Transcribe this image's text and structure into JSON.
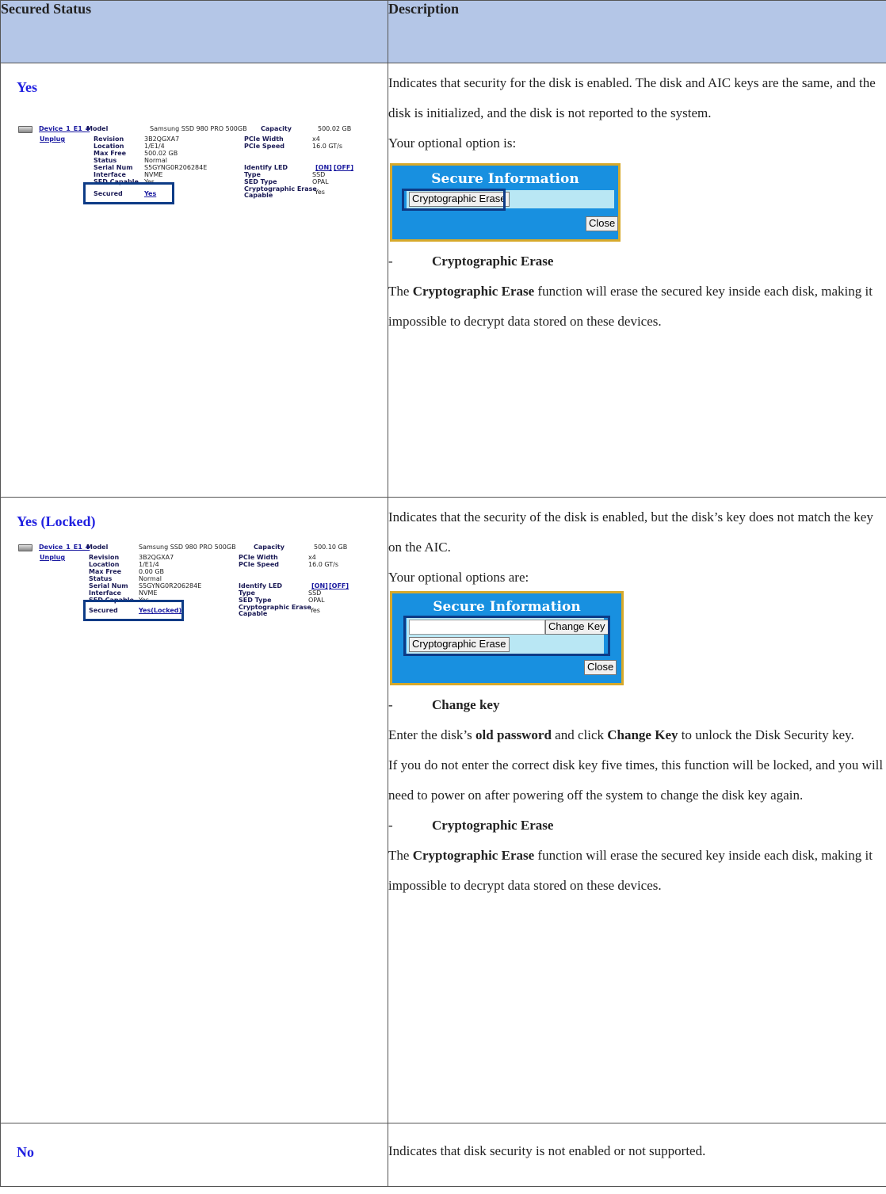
{
  "table": {
    "headers": {
      "status": "Secured Status",
      "description": "Description"
    },
    "rows": [
      {
        "status": "Yes",
        "device": {
          "device_link": "Device_1_E1_4",
          "unplug": "Unplug",
          "model_label": "Model",
          "model": "Samsung SSD 980 PRO 500GB",
          "capacity_label": "Capacity",
          "capacity": "500.02 GB",
          "revision_label": "Revision",
          "revision": "3B2QGXA7",
          "location_label": "Location",
          "location": "1/E1/4",
          "maxfree_label": "Max Free",
          "maxfree": "500.02 GB",
          "status_label": "Status",
          "status": "Normal",
          "serial_label": "Serial Num",
          "serial": "S5GYNG0R206284E",
          "interface_label": "Interface",
          "interface": "NVME",
          "sed_label": "SED Capable",
          "sed": "Yes",
          "secured_label": "Secured",
          "secured": "Yes",
          "pciew_label": "PCIe Width",
          "pciew": "x4",
          "pcies_label": "PCIe Speed",
          "pcies": "16.0 GT/s",
          "led_label": "Identify LED",
          "led_on": "[ON]",
          "led_off": "[OFF]",
          "type_label": "Type",
          "type": "SSD",
          "sedtype_label": "SED Type",
          "sedtype": "OPAL",
          "crypto_label1": "Cryptographic Erase",
          "crypto_label2": "Capable",
          "crypto": "Yes"
        },
        "desc": {
          "p1": "Indicates that security for the disk is enabled. The disk and AIC keys are the same, and the disk is initialized, and the disk is not reported to the system.",
          "p2": "Your optional option is:",
          "dialog_title": "Secure Information",
          "erase_btn": "Cryptographic Erase",
          "close_btn": "Close",
          "item_dash": "-",
          "item_title": "Cryptographic Erase",
          "p3_a": "The ",
          "p3_b": "Cryptographic Erase",
          "p3_c": " function will erase the secured key inside each disk, making it impossible to decrypt data stored on these devices."
        }
      },
      {
        "status": "Yes (Locked)",
        "device": {
          "device_link": "Device_1_E1_4",
          "unplug": "Unplug",
          "model_label": "Model",
          "model": "Samsung SSD 980 PRO 500GB",
          "capacity_label": "Capacity",
          "capacity": "500.10 GB",
          "revision_label": "Revision",
          "revision": "3B2QGXA7",
          "location_label": "Location",
          "location": "1/E1/4",
          "maxfree_label": "Max Free",
          "maxfree": "0.00 GB",
          "status_label": "Status",
          "status": "Normal",
          "serial_label": "Serial Num",
          "serial": "S5GYNG0R206284E",
          "interface_label": "Interface",
          "interface": "NVME",
          "sed_label": "SED Capable",
          "sed": "Yes",
          "secured_label": "Secured",
          "secured": "Yes(Locked)",
          "pciew_label": "PCIe Width",
          "pciew": "x4",
          "pcies_label": "PCIe Speed",
          "pcies": "16.0 GT/s",
          "led_label": "Identify LED",
          "led_on": "[ON]",
          "led_off": "[OFF]",
          "type_label": "Type",
          "type": "SSD",
          "sedtype_label": "SED Type",
          "sedtype": "OPAL",
          "crypto_label1": "Cryptographic Erase",
          "crypto_label2": "Capable",
          "crypto": "Yes"
        },
        "desc": {
          "p1": "Indicates that the security of the disk is enabled, but the disk’s key does not match the key on the AIC.",
          "p2": "Your optional options are:",
          "dialog_title": "Secure Information",
          "change_btn": "Change Key",
          "erase_btn": "Cryptographic Erase",
          "close_btn": "Close",
          "item1_dash": "-",
          "item1_title": "Change key",
          "p3_a": "Enter the disk’s ",
          "p3_b": "old password",
          "p3_c": " and click ",
          "p3_d": "Change Key",
          "p3_e": " to unlock the Disk Security key.",
          "p4": "If you do not enter the correct disk key five times, this function will be locked, and you will need to power on after powering off the system to change the disk key again.",
          "item2_dash": "-",
          "item2_title": "Cryptographic Erase",
          "p5_a": "The ",
          "p5_b": "Cryptographic Erase",
          "p5_c": " function will erase the secured key inside each disk, making it impossible to decrypt data stored on these devices."
        }
      },
      {
        "status": "No",
        "desc": {
          "p1": "Indicates that disk security is not enabled or not supported."
        }
      }
    ]
  }
}
